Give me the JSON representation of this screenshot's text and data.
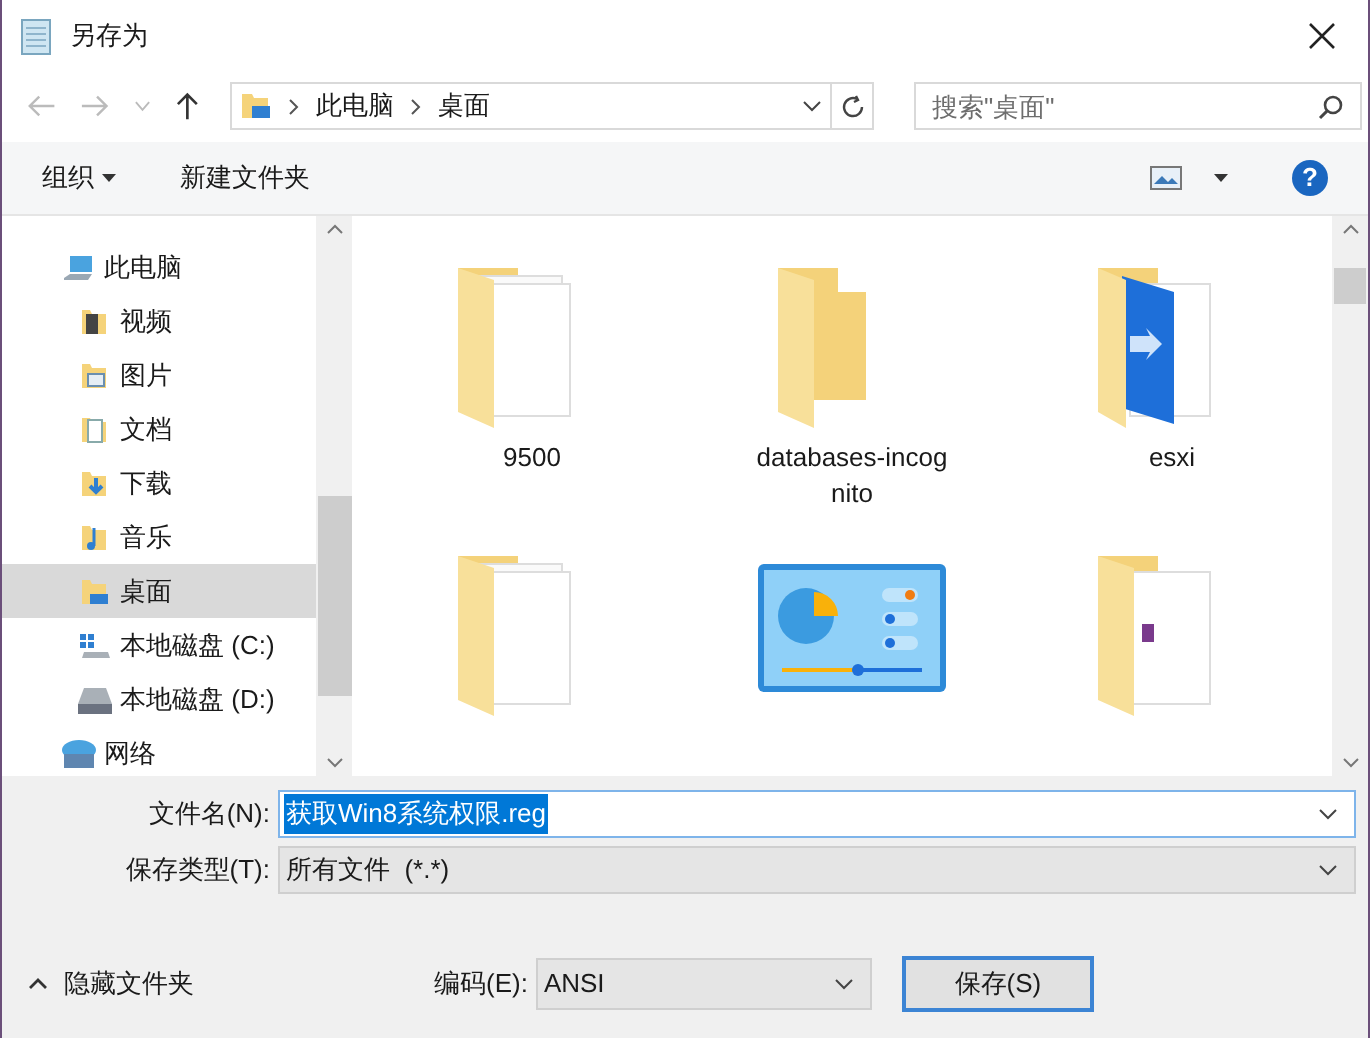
{
  "window": {
    "title": "另存为"
  },
  "address": {
    "path": [
      "此电脑",
      "桌面"
    ]
  },
  "search": {
    "placeholder": "搜索\"桌面\""
  },
  "toolbar": {
    "organize": "组织",
    "new_folder": "新建文件夹",
    "help": "?"
  },
  "sidebar": {
    "items": [
      {
        "label": "此电脑",
        "kind": "computer",
        "selected": false,
        "children": [
          {
            "label": "视频",
            "kind": "video",
            "selected": false
          },
          {
            "label": "图片",
            "kind": "pictures",
            "selected": false
          },
          {
            "label": "文档",
            "kind": "documents",
            "selected": false
          },
          {
            "label": "下载",
            "kind": "downloads",
            "selected": false
          },
          {
            "label": "音乐",
            "kind": "music",
            "selected": false
          },
          {
            "label": "桌面",
            "kind": "desktop",
            "selected": true
          },
          {
            "label": "本地磁盘 (C:)",
            "kind": "system-drive",
            "selected": false
          },
          {
            "label": "本地磁盘 (D:)",
            "kind": "drive",
            "selected": false
          }
        ]
      },
      {
        "label": "网络",
        "kind": "network",
        "selected": false
      }
    ]
  },
  "files": [
    {
      "name": "9500",
      "kind": "folder-doc"
    },
    {
      "name": "databases-incognito",
      "kind": "folder"
    },
    {
      "name": "esxi",
      "kind": "folder-app"
    },
    {
      "kind": "folder-doc"
    },
    {
      "kind": "control-panel"
    },
    {
      "kind": "folder-archive"
    }
  ],
  "form": {
    "filename_label": "文件名(N):",
    "filename": "获取Win8系统权限.reg",
    "filename_selected": true,
    "filetype_label": "保存类型(T):",
    "filetype": "所有文件  (*.*)",
    "encoding_label": "编码(E):",
    "encoding": "ANSI",
    "save": "保存(S)",
    "hide_folders": "隐藏文件夹"
  }
}
